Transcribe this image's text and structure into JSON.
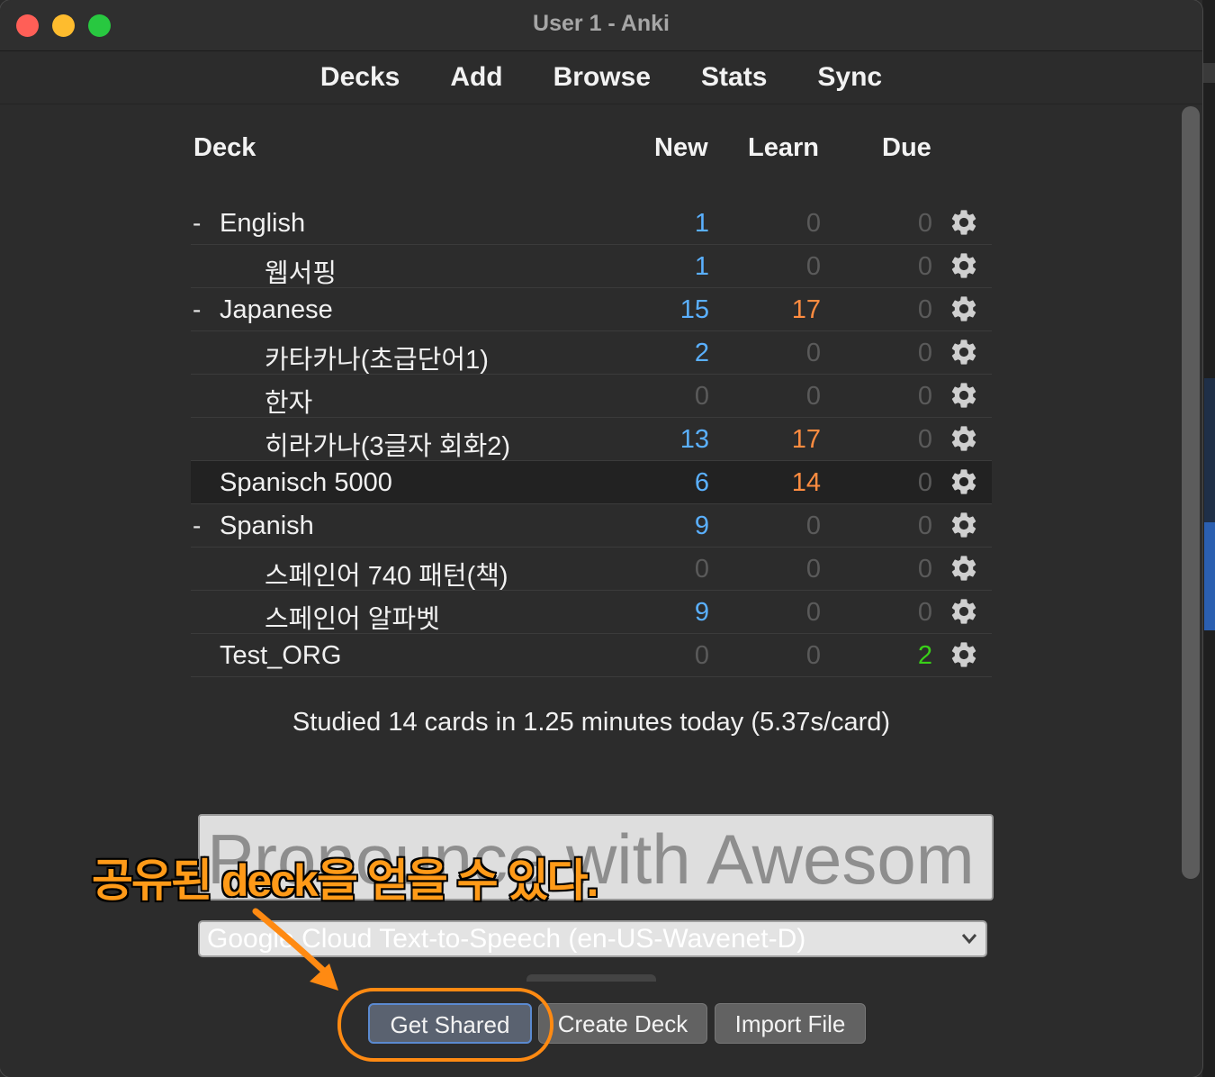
{
  "window": {
    "title": "User 1 - Anki"
  },
  "toolbar": {
    "items": [
      "Decks",
      "Add",
      "Browse",
      "Stats",
      "Sync"
    ]
  },
  "table": {
    "headers": {
      "deck": "Deck",
      "new": "New",
      "learn": "Learn",
      "due": "Due"
    },
    "rows": [
      {
        "collapse": "-",
        "name": "English",
        "indent": 0,
        "new": "1",
        "learn": "0",
        "due": "0"
      },
      {
        "collapse": "",
        "name": "웹서핑",
        "indent": 1,
        "new": "1",
        "learn": "0",
        "due": "0"
      },
      {
        "collapse": "-",
        "name": "Japanese",
        "indent": 0,
        "new": "15",
        "learn": "17",
        "due": "0"
      },
      {
        "collapse": "",
        "name": "카타카나(초급단어1)",
        "indent": 1,
        "new": "2",
        "learn": "0",
        "due": "0"
      },
      {
        "collapse": "",
        "name": "한자",
        "indent": 1,
        "new": "0",
        "learn": "0",
        "due": "0"
      },
      {
        "collapse": "",
        "name": "히라가나(3글자 회화2)",
        "indent": 1,
        "new": "13",
        "learn": "17",
        "due": "0"
      },
      {
        "collapse": "",
        "name": "Spanisch 5000",
        "indent": 0,
        "new": "6",
        "learn": "14",
        "due": "0",
        "selected": true
      },
      {
        "collapse": "-",
        "name": "Spanish",
        "indent": 0,
        "new": "9",
        "learn": "0",
        "due": "0"
      },
      {
        "collapse": "",
        "name": "스페인어 740 패턴(책)",
        "indent": 1,
        "new": "0",
        "learn": "0",
        "due": "0"
      },
      {
        "collapse": "",
        "name": "스페인어 알파벳",
        "indent": 1,
        "new": "9",
        "learn": "0",
        "due": "0"
      },
      {
        "collapse": "",
        "name": "Test_ORG",
        "indent": 0,
        "new": "0",
        "learn": "0",
        "due": "2"
      }
    ]
  },
  "studied": "Studied 14 cards in 1.25 minutes today (5.37s/card)",
  "textbox": {
    "value": "Pronounce with Awesom"
  },
  "voice_select": {
    "selected": "Google Cloud Text-to-Speech (en-US-Wavenet-D)"
  },
  "buttons": {
    "get_shared": "Get Shared",
    "create_deck": "Create Deck",
    "import_file": "Import File"
  },
  "annotation": {
    "text": "공유된 deck을 얻을 수 있다."
  },
  "colors": {
    "new": "#5ab0ff",
    "learn": "#ff8c40",
    "due": "#39d018",
    "zero": "#5a5a5a",
    "accent": "#ff8a12"
  },
  "icons": {
    "options": "gear-icon",
    "select_arrow": "chevron-down-icon"
  }
}
